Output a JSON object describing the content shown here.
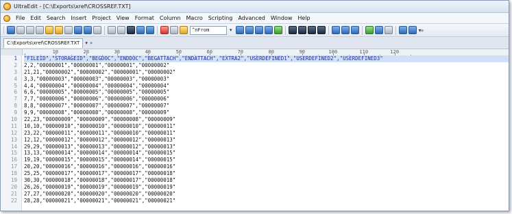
{
  "window": {
    "title": "UltraEdit - [C:\\Exports\\xref\\CROSSREF.TXT]"
  },
  "menu": [
    "File",
    "Edit",
    "Search",
    "Insert",
    "Project",
    "View",
    "Format",
    "Column",
    "Macro",
    "Scripting",
    "Advanced",
    "Window",
    "Help"
  ],
  "toolbar": {
    "find_value": "^nFrom"
  },
  "tab": {
    "label": "C:\\Exports\\xref\\CROSSREF.TXT"
  },
  "ruler": {
    "labels": [
      "10",
      "20",
      "30",
      "40",
      "50",
      "60",
      "70",
      "80",
      "90",
      "100",
      "110",
      "120"
    ]
  },
  "lines": [
    {
      "n": "1",
      "text": "\"FILEID\",\"STORAGEID\",\"BEGDOC\",\"ENDDOC\",\"BEGATTACH\",\"ENDATTACH\",\"EXTRA2\",\"USERDEFINED1\",\"USERDEFINED2\",\"USERDEFINED3\""
    },
    {
      "n": "2",
      "text": "2,2,\"00000001\",\"00000001\",\"00000001\",\"00000002\""
    },
    {
      "n": "3",
      "text": "21,21,\"00000002\",\"00000002\",\"00000001\",\"00000002\""
    },
    {
      "n": "4",
      "text": "3,3,\"00000003\",\"00000003\",\"00000003\",\"00000003\""
    },
    {
      "n": "5",
      "text": "4,4,\"00000004\",\"00000004\",\"00000004\",\"00000004\""
    },
    {
      "n": "6",
      "text": "6,6,\"00000005\",\"00000005\",\"00000005\",\"00000005\""
    },
    {
      "n": "7",
      "text": "7,7,\"00000006\",\"00000006\",\"00000006\",\"00000006\""
    },
    {
      "n": "8",
      "text": "8,8,\"00000007\",\"00000007\",\"00000007\",\"00000007\""
    },
    {
      "n": "9",
      "text": "9,9,\"00000008\",\"00000008\",\"00000008\",\"00000009\""
    },
    {
      "n": "10",
      "text": "22,23,\"00000009\",\"00000009\",\"00000008\",\"00000009\""
    },
    {
      "n": "11",
      "text": "10,10,\"00000010\",\"00000010\",\"00000010\",\"00000011\""
    },
    {
      "n": "12",
      "text": "23,22,\"00000011\",\"00000011\",\"00000010\",\"00000011\""
    },
    {
      "n": "13",
      "text": "12,12,\"00000012\",\"00000012\",\"00000012\",\"00000013\""
    },
    {
      "n": "14",
      "text": "29,29,\"00000013\",\"00000013\",\"00000012\",\"00000013\""
    },
    {
      "n": "15",
      "text": "13,13,\"00000014\",\"00000014\",\"00000014\",\"00000015\""
    },
    {
      "n": "16",
      "text": "19,19,\"00000015\",\"00000015\",\"00000014\",\"00000015\""
    },
    {
      "n": "17",
      "text": "20,20,\"00000016\",\"00000016\",\"00000016\",\"00000016\""
    },
    {
      "n": "18",
      "text": "25,25,\"00000017\",\"00000017\",\"00000017\",\"00000018\""
    },
    {
      "n": "19",
      "text": "30,30,\"00000018\",\"00000018\",\"00000017\",\"00000018\""
    },
    {
      "n": "20",
      "text": "26,26,\"00000019\",\"00000019\",\"00000019\",\"00000019\""
    },
    {
      "n": "21",
      "text": "27,27,\"00000020\",\"00000020\",\"00000020\",\"00000020\""
    },
    {
      "n": "22",
      "text": "28,28,\"00000021\",\"00000021\",\"00000021\",\"00000021\""
    }
  ],
  "colors": {
    "selection": "#cfe0f7",
    "selection_text": "#1a2c9a",
    "chrome": "#dfe6ef"
  }
}
